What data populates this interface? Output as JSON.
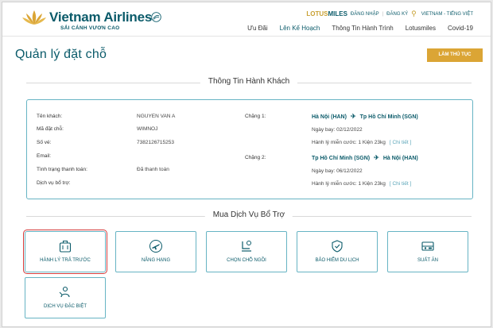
{
  "header": {
    "brand": "Vietnam Airlines",
    "slogan": "SẢI CÁNH VƯƠN CAO",
    "lotusmiles": {
      "brand_a": "LOTUS",
      "brand_b": "MILES"
    },
    "login": "ĐĂNG NHẬP",
    "register": "ĐĂNG KÝ",
    "language": "VIETNAM - TIẾNG VIỆT",
    "nav": [
      "Ưu Đãi",
      "Lên Kế Hoạch",
      "Thông Tin Hành Trình",
      "Lotusmiles",
      "Covid-19"
    ]
  },
  "page_title": "Quản lý đặt chỗ",
  "checkin_label": "LÀM THỦ TỤC",
  "passenger_section_title": "Thông Tin Hành Khách",
  "passenger": {
    "name_label": "Tên khách:",
    "name": "NGUYEN VAN A",
    "code_label": "Mã đặt chỗ:",
    "code": "WIMNOJ",
    "ticket_label": "Số vé:",
    "ticket": "7382126715253",
    "email_label": "Email:",
    "email": "",
    "payment_label": "Tình trạng thanh toán:",
    "payment": "Đã thanh toán",
    "extra_label": "Dịch vụ bổ trợ:",
    "extra": ""
  },
  "legs": [
    {
      "label": "Chặng 1:",
      "from": "Hà Nội (HAN)",
      "to": "Tp Hồ Chí Minh (SGN)",
      "date_label": "Ngày bay:",
      "date": "02/12/2022",
      "baggage_label": "Hành lý miễn cước:",
      "baggage": "1 Kiện 23kg",
      "details": "[ Chi tiết ]"
    },
    {
      "label": "Chặng 2:",
      "from": "Tp Hồ Chí Minh (SGN)",
      "to": "Hà Nội (HAN)",
      "date_label": "Ngày bay:",
      "date": "06/12/2022",
      "baggage_label": "Hành lý miễn cước:",
      "baggage": "1 Kiện 23kg",
      "details": "[ Chi tiết ]"
    }
  ],
  "services_section_title": "Mua Dịch Vụ Bổ Trợ",
  "services": [
    {
      "label": "HÀNH LÝ TRẢ TRƯỚC",
      "icon": "baggage-icon",
      "selected": true
    },
    {
      "label": "NÂNG HẠNG",
      "icon": "upgrade-plane-icon"
    },
    {
      "label": "CHỌN CHỖ NGỒI",
      "icon": "seat-icon"
    },
    {
      "label": "BẢO HIỂM DU LỊCH",
      "icon": "insurance-icon"
    },
    {
      "label": "SUẤT ĂN",
      "icon": "meal-icon"
    },
    {
      "label": "DỊCH VỤ ĐẶC BIỆT",
      "icon": "special-service-icon"
    }
  ],
  "colors": {
    "brand_teal": "#0b5b6a",
    "gold": "#dba535",
    "border_teal": "#67b4c4",
    "selected_red": "#d63b3b"
  }
}
